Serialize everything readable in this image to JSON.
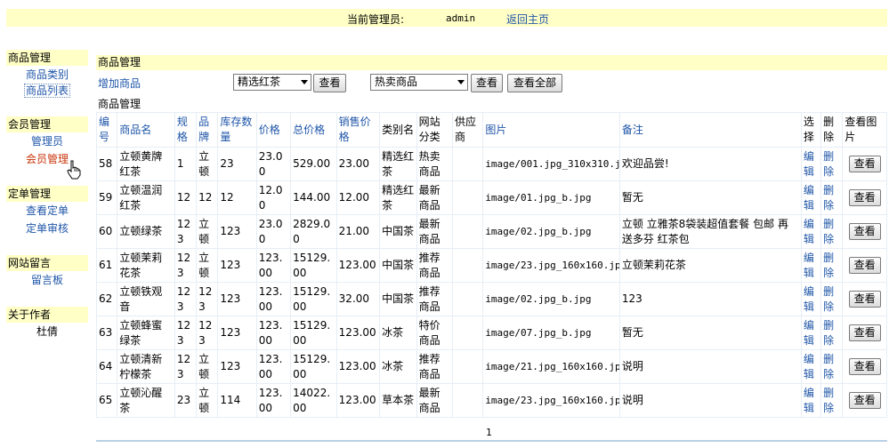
{
  "topbar": {
    "admin_label": "当前管理员:",
    "admin_name": "admin",
    "home_link": "返回主页"
  },
  "sidebar": {
    "groups": [
      {
        "title": "商品管理",
        "items": [
          "商品类别",
          "商品列表"
        ]
      },
      {
        "title": "会员管理",
        "items": [
          "管理员",
          "会员管理"
        ]
      },
      {
        "title": "定单管理",
        "items": [
          "查看定单",
          "定单审核"
        ]
      },
      {
        "title": "网站留言",
        "items": [
          "留言板"
        ]
      },
      {
        "title": "关于作者",
        "items": [
          "杜倩"
        ]
      }
    ]
  },
  "main": {
    "title": "商品管理",
    "add_link": "增加商品",
    "category_select": "精选红茶",
    "type_select": "热卖商品",
    "view_button": "查看",
    "view_all_button": "查看全部",
    "sub_title": "商品管理"
  },
  "table": {
    "headers": [
      "编号",
      "商品名",
      "规格",
      "品牌",
      "库存数量",
      "价格",
      "总价格",
      "销售价格",
      "类别名",
      "网站分类",
      "供应商",
      "图片",
      "备注",
      "选择",
      "删除",
      "查看图片"
    ],
    "rows": [
      [
        "58",
        "立顿黄牌红茶",
        "1",
        "立顿",
        "23",
        "23.00",
        "529.00",
        "23.00",
        "精选红茶",
        "热卖商品",
        "",
        "image/001.jpg_310x310.jpg",
        "欢迎品尝!",
        "编辑",
        "删除",
        "查看"
      ],
      [
        "59",
        "立顿温润红茶",
        "12",
        "12",
        "12",
        "12.00",
        "144.00",
        "12.00",
        "精选红茶",
        "最新商品",
        "",
        "image/01.jpg_b.jpg",
        "暂无",
        "编辑",
        "删除",
        "查看"
      ],
      [
        "60",
        "立顿绿茶",
        "123",
        "立顿",
        "123",
        "23.00",
        "2829.00",
        "21.00",
        "中国茶",
        "最新商品",
        "",
        "image/02.jpg_b.jpg",
        "立顿 立雅茶8袋装超值套餐 包邮 再送多芬 红茶包",
        "编辑",
        "删除",
        "查看"
      ],
      [
        "61",
        "立顿茉莉花茶",
        "123",
        "立顿",
        "123",
        "123.00",
        "15129.00",
        "123.00",
        "中国茶",
        "推荐商品",
        "",
        "image/23.jpg_160x160.jpg",
        "立顿茉莉花茶",
        "编辑",
        "删除",
        "查看"
      ],
      [
        "62",
        "立顿铁观音",
        "123",
        "123",
        "123",
        "123.00",
        "15129.00",
        "32.00",
        "中国茶",
        "推荐商品",
        "",
        "image/02.jpg_b.jpg",
        "123",
        "编辑",
        "删除",
        "查看"
      ],
      [
        "63",
        "立顿蜂蜜绿茶",
        "123",
        "123",
        "123",
        "123.00",
        "15129.00",
        "123.00",
        "冰茶",
        "特价商品",
        "",
        "image/07.jpg_b.jpg",
        "暂无",
        "编辑",
        "删除",
        "查看"
      ],
      [
        "64",
        "立顿清新柠檬茶",
        "123",
        "立顿",
        "123",
        "123.00",
        "15129.00",
        "123.00",
        "冰茶",
        "推荐商品",
        "",
        "image/21.jpg_160x160.jpg",
        "说明",
        "编辑",
        "删除",
        "查看"
      ],
      [
        "65",
        "立顿沁醒茶",
        "23",
        "立顿",
        "114",
        "123.00",
        "14022.00",
        "123.00",
        "草本茶",
        "最新商品",
        "",
        "image/23.jpg_160x160.jpg",
        "说明",
        "编辑",
        "删除",
        "查看"
      ]
    ]
  },
  "pagination": {
    "current_page": "1"
  }
}
